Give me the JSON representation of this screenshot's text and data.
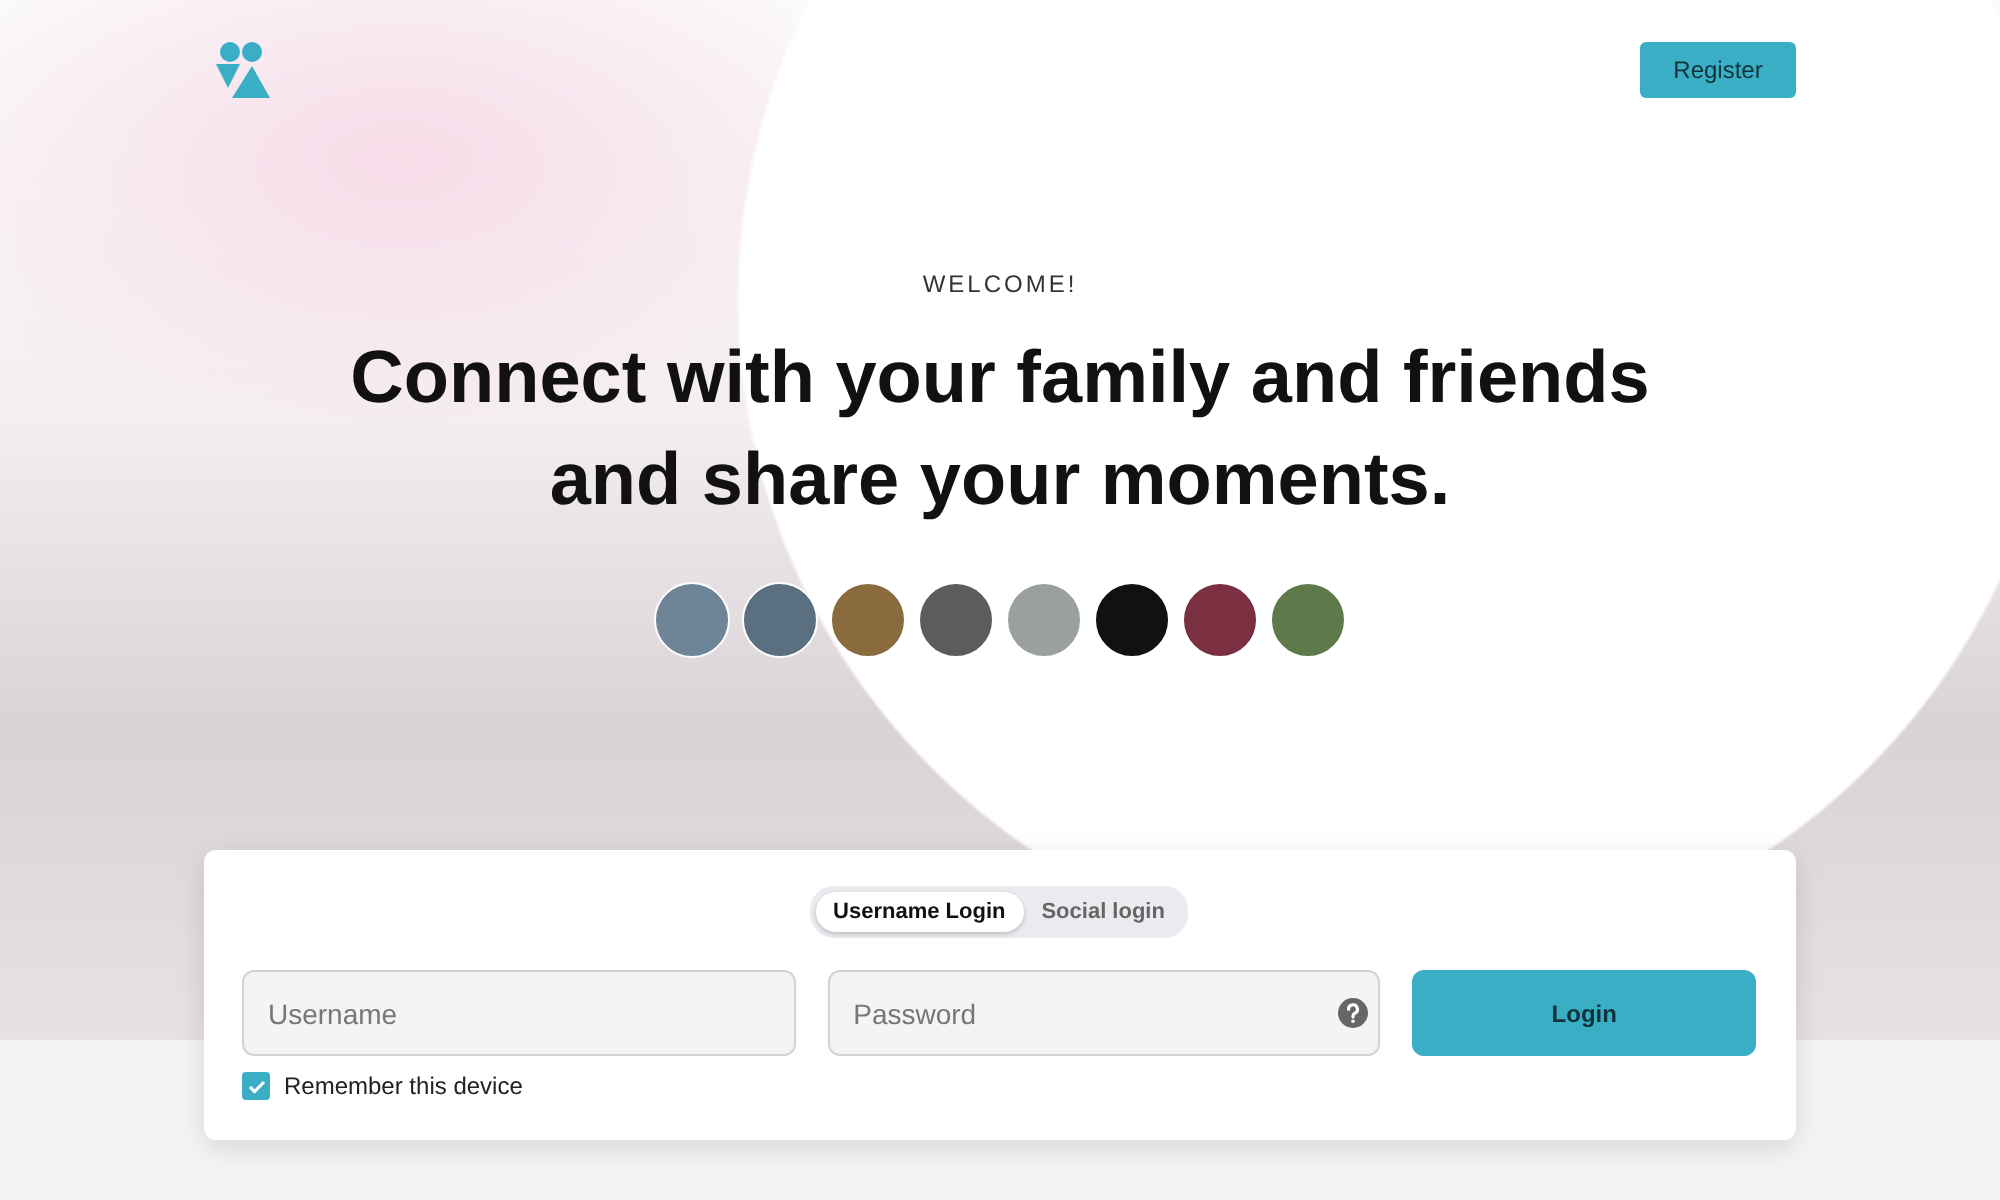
{
  "header": {
    "register_button": "Register"
  },
  "hero": {
    "eyebrow": "WELCOME!",
    "headline": [
      "Connect with your family and friends",
      "and share your moments."
    ],
    "avatars": [
      {
        "kind": "photo"
      },
      {
        "kind": "photo"
      },
      {
        "kind": "photo"
      },
      {
        "kind": "photo"
      },
      {
        "kind": "photo"
      },
      {
        "kind": "photo"
      },
      {
        "kind": "photo"
      },
      {
        "kind": "photo"
      }
    ]
  },
  "login": {
    "tabs": [
      {
        "label": "Username Login",
        "selected": true
      },
      {
        "label": "Social login",
        "selected": false
      }
    ],
    "username": {
      "placeholder": "Username"
    },
    "password": {
      "placeholder": "Password",
      "help": true
    },
    "remember": {
      "label": "Remember this device",
      "checked": true
    },
    "submit": "Login"
  }
}
